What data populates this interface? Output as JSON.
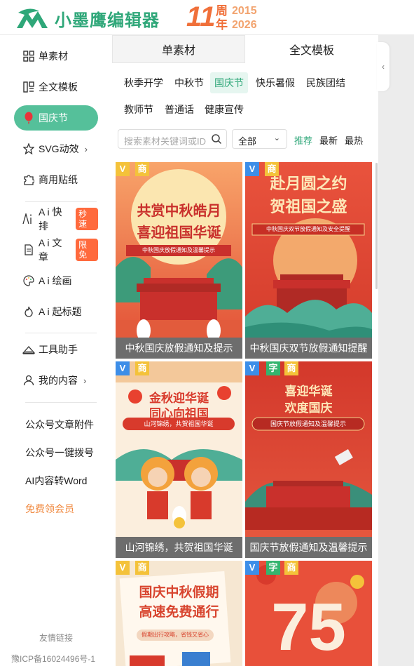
{
  "header": {
    "logo_text": "小墨鹰编辑器",
    "anniv_number": "11",
    "anniv_char_1": "周",
    "anniv_char_2": "年",
    "anniv_year_1": "2015",
    "anniv_year_2": "2026"
  },
  "sidebar": {
    "items": [
      {
        "label": "单素材",
        "icon": "grid-icon"
      },
      {
        "label": "全文模板",
        "icon": "template-icon"
      },
      {
        "label": "国庆节",
        "icon": "balloon-icon"
      },
      {
        "label": "SVG动效",
        "icon": "star-icon",
        "chevron": "›"
      },
      {
        "label": "商用贴纸",
        "icon": "puzzle-icon"
      },
      {
        "label": "A i 快排",
        "icon": "ai-icon",
        "badge": "秒速"
      },
      {
        "label": "A i 文章",
        "icon": "doc-icon",
        "badge": "限免"
      },
      {
        "label": "A i 绘画",
        "icon": "palette-icon"
      },
      {
        "label": "A i 起标题",
        "icon": "flame-icon"
      },
      {
        "label": "工具助手",
        "icon": "tools-icon"
      },
      {
        "label": "我的内容",
        "icon": "user-icon",
        "chevron": "›"
      }
    ],
    "links": [
      "公众号文章附件",
      "公众号一键拨号",
      "AI内容转Word",
      "免费领会员"
    ],
    "footer_link": "友情链接",
    "icp": "豫ICP备16024496号-1"
  },
  "tabs": [
    "单素材",
    "全文模板"
  ],
  "categories": {
    "row1": [
      "秋季开学",
      "中秋节",
      "国庆节",
      "快乐暑假",
      "民族团结"
    ],
    "row2": [
      "教师节",
      "普通话",
      "健康宣传"
    ]
  },
  "search": {
    "placeholder": "搜索素材关键词或ID"
  },
  "filter": {
    "selected": "全部",
    "chevron": "⌄"
  },
  "sort": [
    "推荐",
    "最新",
    "最热"
  ],
  "cards": [
    {
      "tag_v": "V",
      "tag": "商",
      "caption": "中秋国庆放假通知及提示",
      "headline_1": "共赏中秋皓月",
      "headline_2": "喜迎祖国华诞",
      "ribbon": "中秋国庆放假通知及温馨提示"
    },
    {
      "tag_v": "V",
      "tag": "商",
      "caption": "中秋国庆双节放假通知提醒",
      "headline_1": "赴月圆之约",
      "headline_2": "贺祖国之盛",
      "ribbon": "中秋国庆双节放假通知及安全提醒"
    },
    {
      "tag_v": "V",
      "tag": "商",
      "caption": "山河锦绣，共贺祖国华诞",
      "headline_1": "金秋迎华诞",
      "headline_2": "同心向祖国",
      "ribbon": "山河锦绣，共贺祖国华诞"
    },
    {
      "tag_v": "V",
      "tag_zi": "字",
      "tag": "商",
      "caption": "国庆节放假通知及温馨提示",
      "headline_1": "喜迎华诞",
      "headline_2": "欢度国庆",
      "ribbon": "国庆节放假通知及温馨提示"
    },
    {
      "tag_v": "V",
      "tag": "商",
      "headline_1": "国庆中秋假期",
      "headline_2": "高速免费通行",
      "ribbon": "假期出行攻略，省钱又省心"
    },
    {
      "tag_v": "V",
      "tag_zi": "字",
      "tag": "商",
      "number": "75"
    }
  ]
}
